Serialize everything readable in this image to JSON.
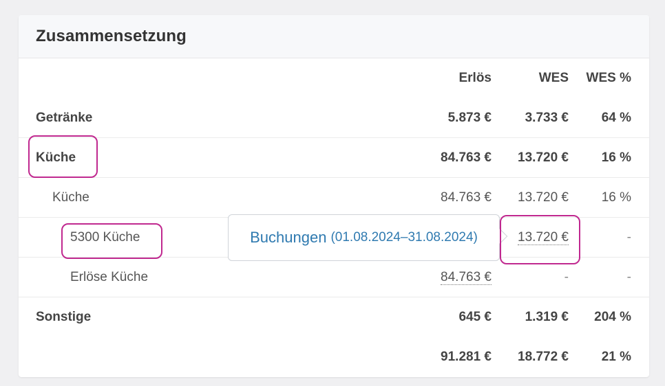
{
  "card": {
    "title": "Zusammensetzung"
  },
  "columns": {
    "erloes": "Erlös",
    "wes": "WES",
    "wes_pct": "WES %"
  },
  "rows": {
    "getraenke": {
      "label": "Getränke",
      "erloes": "5.873 €",
      "wes": "3.733 €",
      "wes_pct": "64 %"
    },
    "kueche": {
      "label": "Küche",
      "erloes": "84.763 €",
      "wes": "13.720 €",
      "wes_pct": "16 %"
    },
    "kueche_sub": {
      "label": "Küche",
      "erloes": "84.763 €",
      "wes": "13.720 €",
      "wes_pct": "16 %"
    },
    "konto_5300": {
      "label": "5300 Küche",
      "wes": "13.720 €",
      "wes_pct": "-"
    },
    "erloese_kueche": {
      "label": "Erlöse Küche",
      "erloes": "84.763 €",
      "wes": "-",
      "wes_pct": "-"
    },
    "sonstige": {
      "label": "Sonstige",
      "erloes": "645 €",
      "wes": "1.319 €",
      "wes_pct": "204 %"
    },
    "total": {
      "erloes": "91.281 €",
      "wes": "18.772 €",
      "wes_pct": "21 %"
    }
  },
  "tooltip": {
    "title": "Buchungen",
    "range": "(01.08.2024–31.08.2024)"
  },
  "colors": {
    "highlight": "#c0288f",
    "link": "#2f7ab0"
  }
}
